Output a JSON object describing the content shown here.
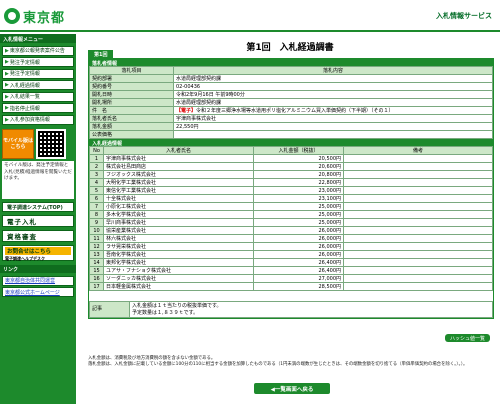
{
  "header": {
    "logo_text": "東京都",
    "service": "入札情報サービス"
  },
  "sidebar": {
    "menu_title": "入札情報メニュー",
    "items": [
      "東京都公報発表案件公告",
      "発注予定情報",
      "発注予定情報",
      "入札経過情報",
      "入札結果一覧",
      "指名停止情報",
      "入札参加資格情報"
    ],
    "mobile_label": "モバイル版はこちら",
    "mobile_note": "モバイル版は、発注予定情報と入札(見積)経過情報を閲覧いただけます。",
    "ebid_button": "電子調達システム(TOP)",
    "ebid_enter": "電子入札",
    "qualification": "資格審査",
    "faq_title": "お問合せはこちら",
    "faq_sub": "電子調達ヘルプデスク",
    "links_title": "リンク",
    "links": [
      "東京都自治体共同運営",
      "東京都公式ホームページ"
    ]
  },
  "main": {
    "page_title": "第1回　入札経過調書",
    "round_tab": "第1回",
    "info_section": "落札者情報",
    "info_headers": [
      "落札項目",
      "落札内容"
    ],
    "info_rows": [
      {
        "k": "契約部署",
        "v": "水道局経理部契約課"
      },
      {
        "k": "契約番号",
        "v": "02-00436"
      },
      {
        "k": "開札日時",
        "v": "令和2年9月16日 午前9時00分"
      },
      {
        "k": "開札場所",
        "v": "水道局経理部契約課"
      },
      {
        "k": "件　名",
        "v_red": "【電子】",
        "v": "令和２年度三郷浄水場等水道用ポリ塩化アルミニウム買入単価契約（下半期）（その１）"
      },
      {
        "k": "落札者氏名",
        "v": "宇津商事株式会社"
      },
      {
        "k": "落札金額",
        "v": "22,550円"
      },
      {
        "k": "公表価格",
        "v": ""
      }
    ],
    "bid_section": "入札経過情報",
    "bid_headers": [
      "No",
      "入札者氏名",
      "入札金額（税抜）",
      "備考"
    ],
    "bids": [
      {
        "no": "1",
        "name": "宇津商事株式会社",
        "amount": "20,500円"
      },
      {
        "no": "2",
        "name": "株式会社島田商店",
        "amount": "20,600円"
      },
      {
        "no": "3",
        "name": "フジオックス株式会社",
        "amount": "20,800円"
      },
      {
        "no": "4",
        "name": "大明化学工業株式会社",
        "amount": "22,800円"
      },
      {
        "no": "5",
        "name": "東信化学工業株式会社",
        "amount": "23,000円"
      },
      {
        "no": "6",
        "name": "十全株式会社",
        "amount": "23,100円"
      },
      {
        "no": "7",
        "name": "小原化工株式会社",
        "amount": "25,000円"
      },
      {
        "no": "8",
        "name": "多木化学株式会社",
        "amount": "25,000円"
      },
      {
        "no": "9",
        "name": "早川商事株式会社",
        "amount": "25,000円"
      },
      {
        "no": "10",
        "name": "協栄産業株式会社",
        "amount": "26,000円"
      },
      {
        "no": "11",
        "name": "林六株式会社",
        "amount": "26,000円"
      },
      {
        "no": "12",
        "name": "ラサ晃栄株式会社",
        "amount": "26,000円"
      },
      {
        "no": "13",
        "name": "吾南化学株式会社",
        "amount": "26,000円"
      },
      {
        "no": "14",
        "name": "東邦化学株式会社",
        "amount": "26,400円"
      },
      {
        "no": "15",
        "name": "ユアサ・フナショク株式会社",
        "amount": "26,400円"
      },
      {
        "no": "16",
        "name": "ソーダニッカ株式会社",
        "amount": "27,000円"
      },
      {
        "no": "17",
        "name": "日本軽金属株式会社",
        "amount": "28,500円"
      }
    ],
    "history_button": "ハッシュ値一覧",
    "memo_label": "記事",
    "memo_line1": "入札金額は１ｔ当たりの税抜単価です。",
    "memo_line2": "予定数量は１,８３９ｔです。",
    "note1": "入札金額は、消費税及び地方消費税の額を含まない金額である。",
    "note2": "落札金額は、入札金額に記載している金額に100分の110に相当する金額を加算したものである（1円未満の端数が生じたときは、その端数金額を切り捨てる（単価単価契約の場合を除く。）。）。",
    "back_button": "◀一覧画面へ戻る"
  }
}
